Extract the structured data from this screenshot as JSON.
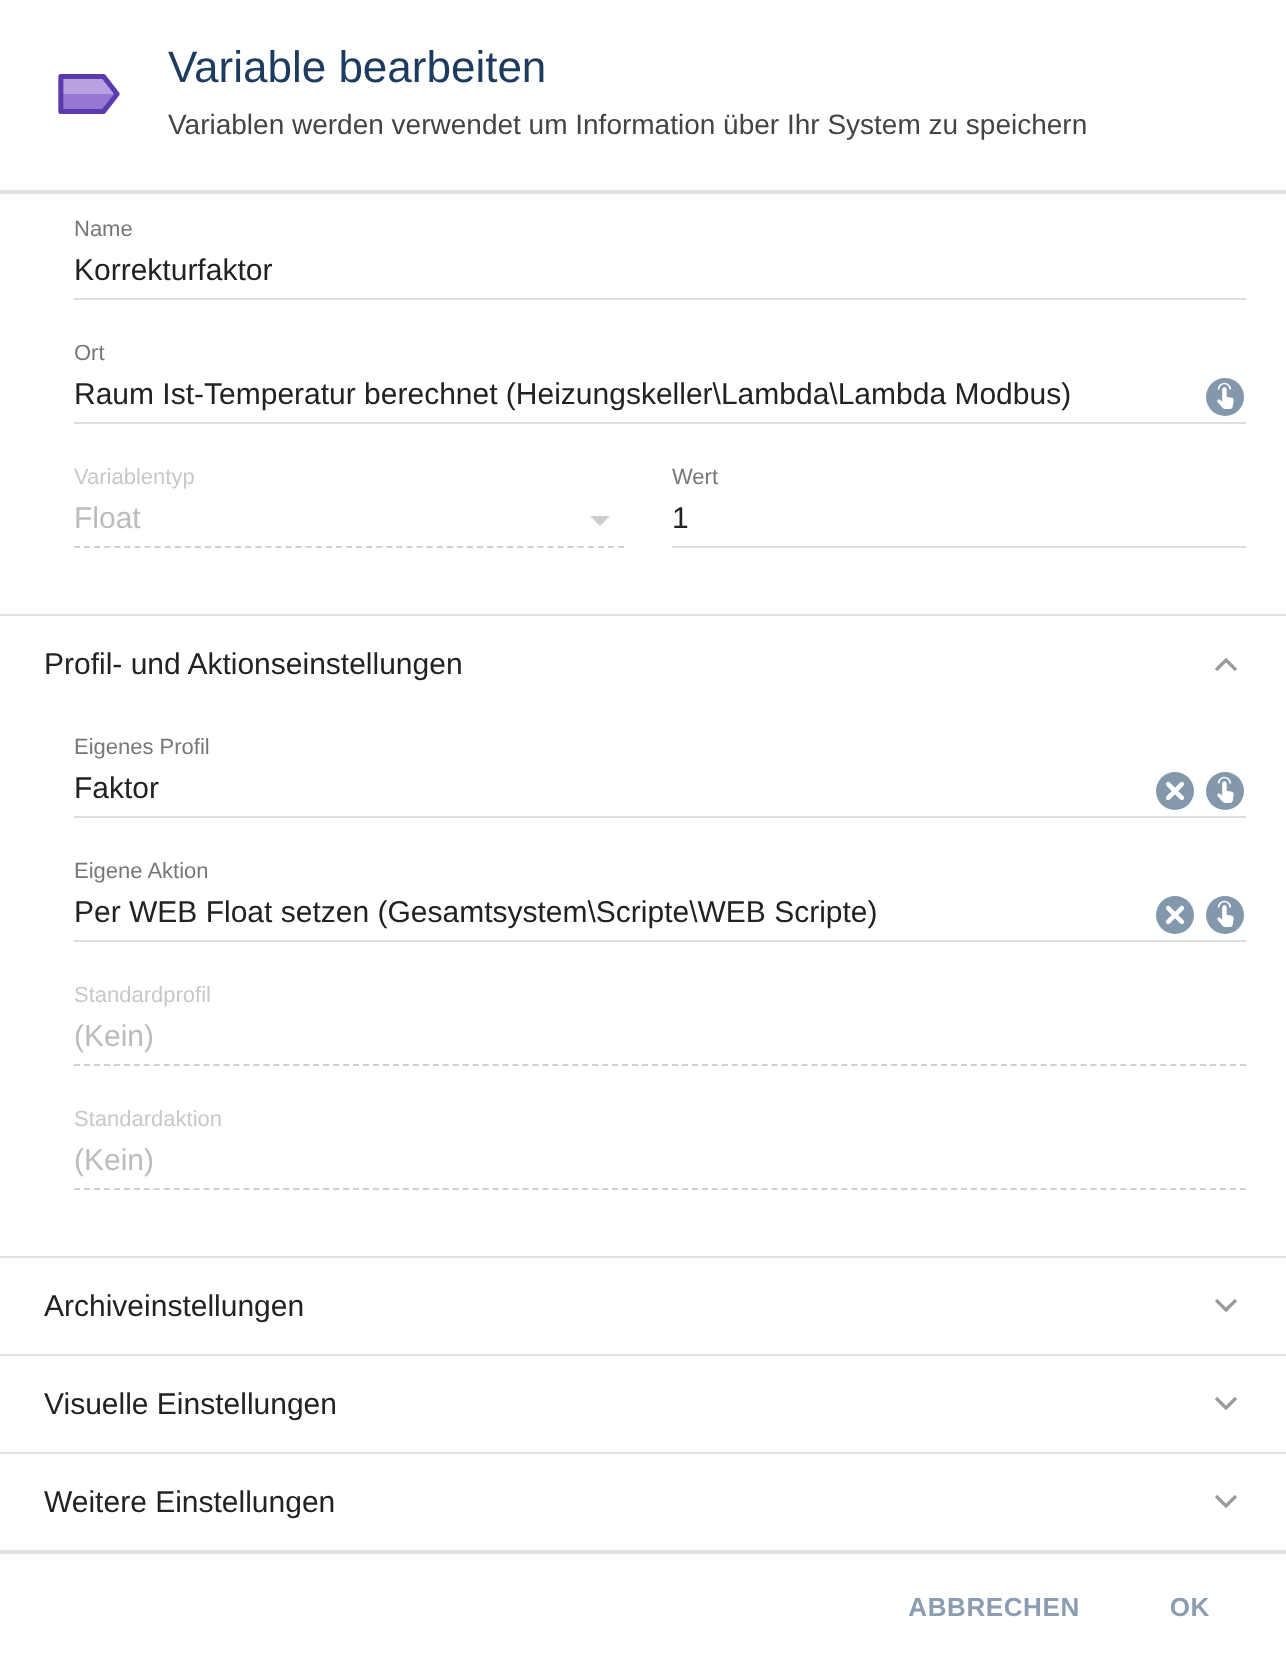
{
  "dialog": {
    "title": "Variable bearbeiten",
    "subtitle": "Variablen werden verwendet um Information über Ihr System zu speichern"
  },
  "general": [
    {
      "kind": "text",
      "label": "Name",
      "value": "Korrekturfaktor",
      "disabled": false
    },
    {
      "kind": "picker",
      "label": "Ort",
      "value": "Raum Ist-Temperatur berechnet (Heizungskeller\\Lambda\\Lambda Modbus)",
      "disabled": false,
      "clearable": false
    }
  ],
  "general_row": [
    {
      "kind": "select",
      "label": "Variablentyp",
      "value": "Float",
      "disabled": true
    },
    {
      "kind": "text",
      "label": "Wert",
      "value": "1",
      "disabled": false
    }
  ],
  "sections": [
    {
      "title": "Profil- und Aktionseinstellungen",
      "expanded": true,
      "fields": [
        {
          "kind": "picker",
          "label": "Eigenes Profil",
          "value": "Faktor",
          "disabled": false,
          "clearable": true
        },
        {
          "kind": "picker",
          "label": "Eigene Aktion",
          "value": "Per WEB Float setzen (Gesamtsystem\\Scripte\\WEB Scripte)",
          "disabled": false,
          "clearable": true
        },
        {
          "kind": "text",
          "label": "Standardprofil",
          "value": "(Kein)",
          "disabled": true
        },
        {
          "kind": "text",
          "label": "Standardaktion",
          "value": "(Kein)",
          "disabled": true
        }
      ]
    },
    {
      "title": "Archiveinstellungen",
      "expanded": false
    },
    {
      "title": "Visuelle Einstellungen",
      "expanded": false
    },
    {
      "title": "Weitere Einstellungen",
      "expanded": false
    }
  ],
  "buttons": [
    "ABBRECHEN",
    "OK"
  ]
}
